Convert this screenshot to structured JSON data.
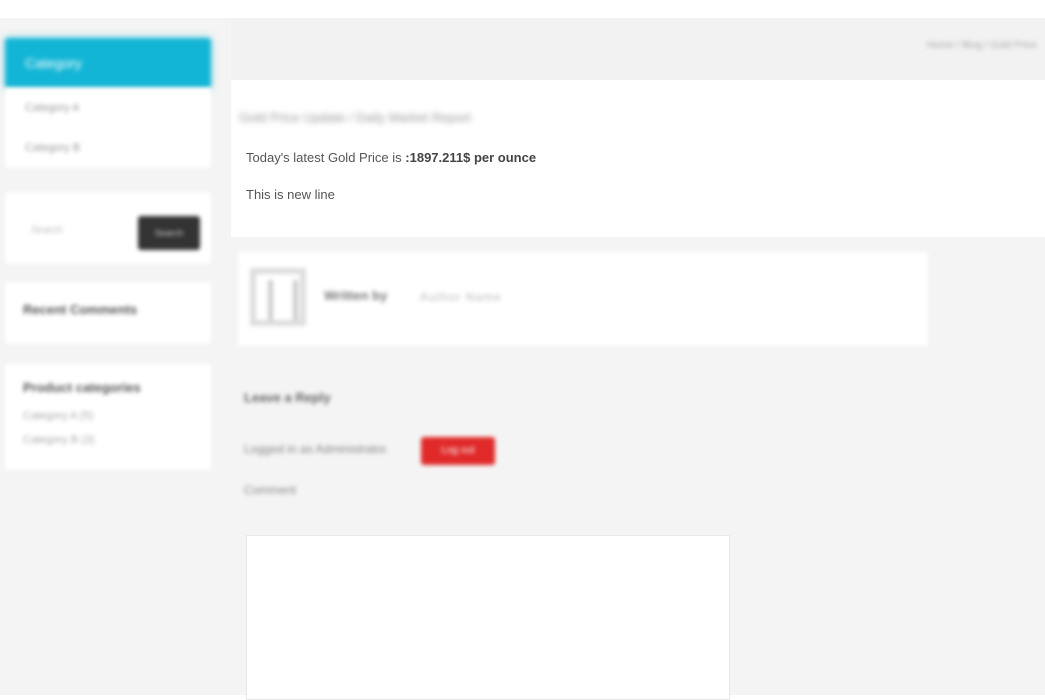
{
  "sidebar": {
    "active_label": "Category",
    "links": [
      "Category A",
      "Category B"
    ],
    "search": {
      "placeholder": "Search",
      "button_label": "Search"
    },
    "recent_title": "Recent Comments",
    "comments_title": "Product categories",
    "comment_lines": [
      "Category A (5)",
      "Category B (3)"
    ]
  },
  "topbar": {
    "breadcrumb": "Home / Blog / Gold Price"
  },
  "post": {
    "title": "Gold Price Update / Daily Market Report",
    "gold_prefix": "Today's latest Gold Price is ",
    "gold_value": ":1897.211$ per ounce",
    "second_line": "This is new line"
  },
  "author": {
    "label": "Written by",
    "name": "Author Name"
  },
  "reply": {
    "title": "Leave a Reply",
    "logged_in": "Logged in as Administrator.",
    "logout_label": "Log out",
    "comment_label": "Comment"
  },
  "colors": {
    "accent": "#13b5d6",
    "danger": "#e02a2a",
    "dark_button": "#333333"
  }
}
